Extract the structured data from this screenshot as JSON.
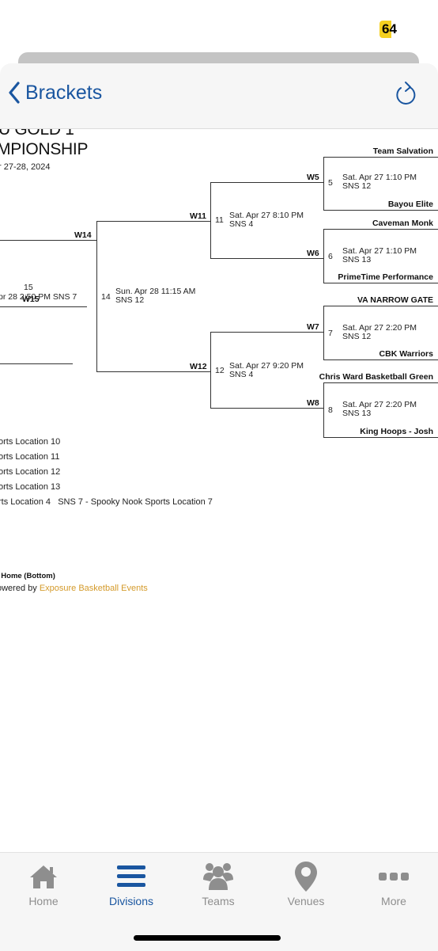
{
  "status_bar": {
    "battery": "64"
  },
  "colors": {
    "accent": "#1a56a0",
    "link": "#d49a2a",
    "inactive_tab": "#8e8e8e"
  },
  "navbar": {
    "back_label": "Brackets",
    "back_icon": "chevron-left-icon",
    "refresh_icon": "refresh-icon"
  },
  "header": {
    "title_line1": "U GOLD 1",
    "title_line2": "MPIONSHIP",
    "dates": "r 27-28, 2024"
  },
  "bracket": {
    "final": {
      "winner_label": "W14",
      "game15": {
        "number": "15",
        "info": "pr 28 2:50 PM SNS 7",
        "winner_label": "W15"
      }
    },
    "semifinal": {
      "number": "14",
      "date": "Sun. Apr 28 11:15 AM",
      "court": "SNS 12"
    },
    "quarterfinals": [
      {
        "number": "11",
        "date": "Sat. Apr 27 8:10 PM",
        "court": "SNS 4",
        "winner_label": "W11"
      },
      {
        "number": "12",
        "date": "Sat. Apr 27 9:20 PM",
        "court": "SNS 4",
        "winner_label": "W12"
      }
    ],
    "first_round": [
      {
        "number": "5",
        "date": "Sat. Apr 27 1:10 PM",
        "court": "SNS 12",
        "winner_label": "W5",
        "top_team": "Team Salvation",
        "bottom_team": "Bayou Elite"
      },
      {
        "number": "6",
        "date": "Sat. Apr 27 1:10 PM",
        "court": "SNS 13",
        "winner_label": "W6",
        "top_team": "Caveman Monk",
        "bottom_team": "PrimeTime Performance"
      },
      {
        "number": "7",
        "date": "Sat. Apr 27 2:20 PM",
        "court": "SNS 12",
        "winner_label": "W7",
        "top_team": "VA NARROW GATE",
        "bottom_team": "CBK Warriors"
      },
      {
        "number": "8",
        "date": "Sat. Apr 27 2:20 PM",
        "court": "SNS 13",
        "winner_label": "W8",
        "top_team": "Chris Ward Basketball Green",
        "bottom_team": "King Hoops - Josh"
      }
    ]
  },
  "legend": {
    "locations": [
      "orts Location 10",
      "orts Location 11",
      "orts Location 12",
      "orts Location 13",
      "rts Location 4   SNS 7 - Spooky Nook Sports Location 7"
    ],
    "note": ", Home (Bottom)",
    "powered_prefix": "owered by ",
    "powered_link": "Exposure Basketball Events"
  },
  "tabbar": {
    "tabs": [
      {
        "label": "Home",
        "icon": "home-icon",
        "active": false
      },
      {
        "label": "Divisions",
        "icon": "list-icon",
        "active": true
      },
      {
        "label": "Teams",
        "icon": "teams-icon",
        "active": false
      },
      {
        "label": "Venues",
        "icon": "map-pin-icon",
        "active": false
      },
      {
        "label": "More",
        "icon": "more-icon",
        "active": false
      }
    ]
  }
}
